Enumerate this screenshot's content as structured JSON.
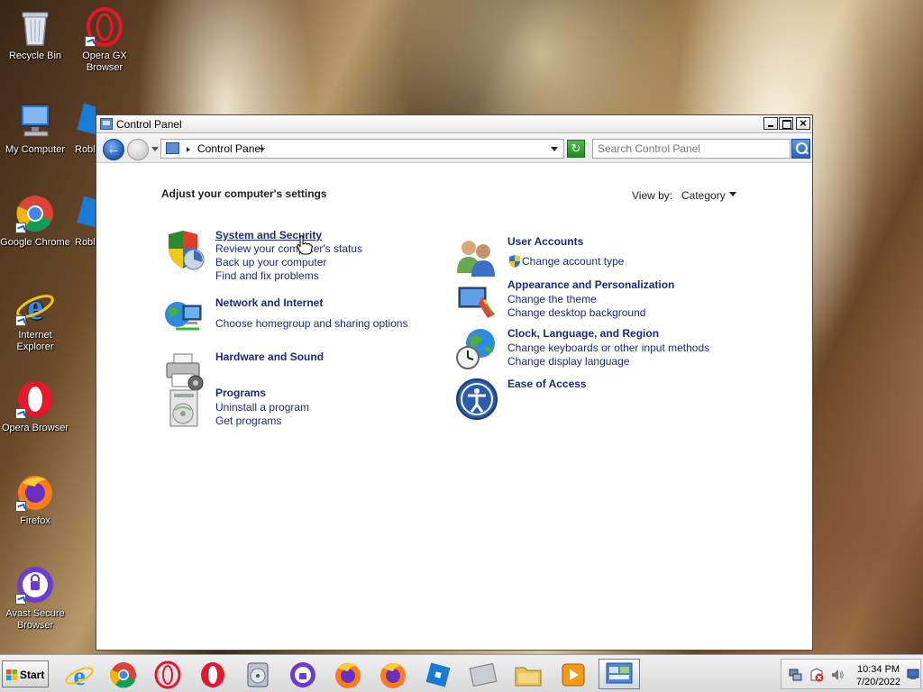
{
  "desktop": {
    "icons": [
      {
        "label": "Recycle Bin"
      },
      {
        "label": "Opera GX Browser"
      },
      {
        "label": "My Computer"
      },
      {
        "label": "Robl"
      },
      {
        "label": "Google Chrome"
      },
      {
        "label": "Robl"
      },
      {
        "label": "Internet Explorer"
      },
      {
        "label": "Opera Browser"
      },
      {
        "label": "Firefox"
      },
      {
        "label": "Avast Secure Browser"
      }
    ]
  },
  "window": {
    "title": "Control Panel",
    "address": {
      "crumb": "Control Panel"
    },
    "search": {
      "placeholder": "Search Control Panel"
    },
    "heading": "Adjust your computer's settings",
    "view_by": {
      "label": "View by:",
      "value": "Category"
    },
    "categories": [
      {
        "title": "System and Security",
        "links": [
          "Review your computer's status",
          "Back up your computer",
          "Find and fix problems"
        ]
      },
      {
        "title": "Network and Internet",
        "links": [
          "Choose homegroup and sharing options"
        ]
      },
      {
        "title": "Hardware and Sound",
        "links": []
      },
      {
        "title": "Programs",
        "links": [
          "Uninstall a program",
          "Get programs"
        ]
      },
      {
        "title": "User Accounts",
        "links": [
          "Change account type"
        ]
      },
      {
        "title": "Appearance and Personalization",
        "links": [
          "Change the theme",
          "Change desktop background"
        ]
      },
      {
        "title": "Clock, Language, and Region",
        "links": [
          "Change keyboards or other input methods",
          "Change display language"
        ]
      },
      {
        "title": "Ease of Access",
        "links": []
      }
    ]
  },
  "taskbar": {
    "start_label": "Start",
    "clock": {
      "time": "10:34 PM",
      "date": "7/20/2022"
    }
  },
  "colors": {
    "link": "#1b2a7a",
    "accent": "#2860b8"
  }
}
